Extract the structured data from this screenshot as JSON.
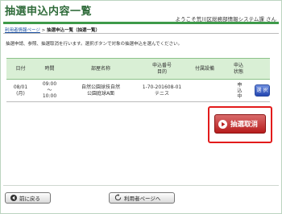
{
  "header": {
    "title": "抽選申込内容一覧",
    "user_text": "ようこそ荒川区総務部情報システム課 さん"
  },
  "breadcrumb": {
    "link": "利用者情報ページ",
    "sep": " > ",
    "current": "抽選申込一覧（抽選一覧）"
  },
  "description": "抽選申請、参照、抽選取消を行います。選択ボタンで対象の抽選申込を選んでください。",
  "table": {
    "headers": [
      "日付",
      "時間",
      "部屋名称",
      "申込番号\n目的",
      "付属設備",
      "申込\n状態",
      ""
    ],
    "row": {
      "date": "08/01\n(月)",
      "time": "09:00\n～\n10:00",
      "room": "自然公園球技自然\n公園庭球A面",
      "number_purpose": "1-70-201608-01\nテニス",
      "equipment": "",
      "status": "申込中",
      "select_label": "選 択"
    }
  },
  "actions": {
    "cancel_lottery": "抽選取消"
  },
  "footer": {
    "back": "前に戻る",
    "user_page": "利用者ページへ"
  },
  "colors": {
    "accent": "#3e9a4a",
    "header_bg": "#d9efd5",
    "danger": "#e31b1b",
    "select_blue": "#2346b0"
  }
}
